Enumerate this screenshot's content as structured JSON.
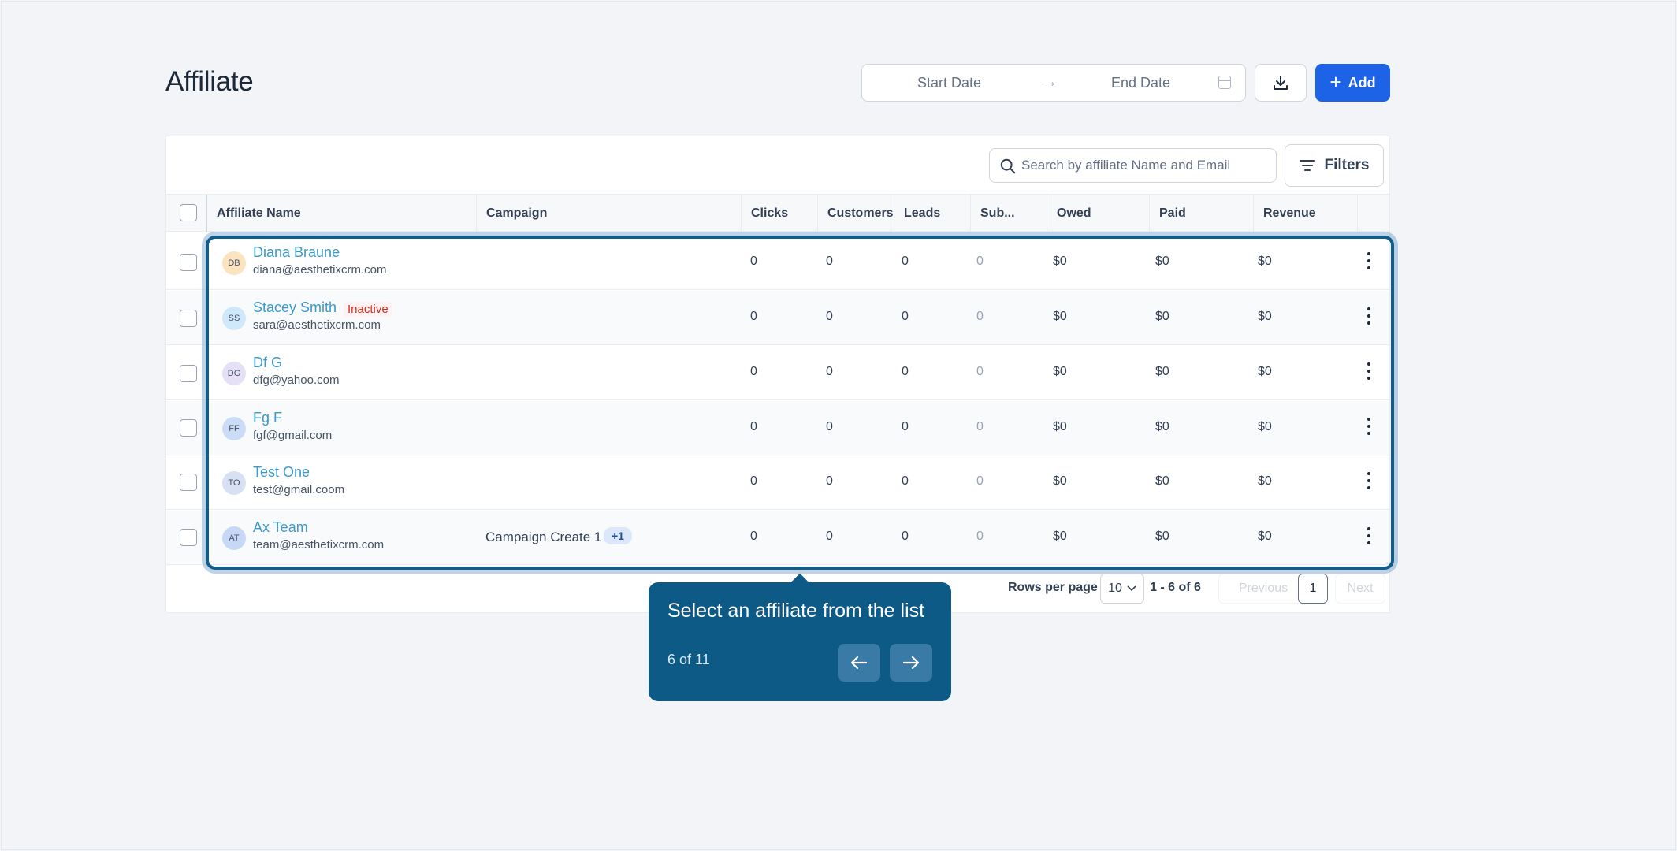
{
  "header": {
    "title": "Affiliate",
    "start_date_placeholder": "Start Date",
    "end_date_placeholder": "End Date",
    "add_label": "Add"
  },
  "toolbar": {
    "search_placeholder": "Search by affiliate Name and Email",
    "filters_label": "Filters"
  },
  "table": {
    "columns": [
      "Affiliate Name",
      "Campaign",
      "Clicks",
      "Customers",
      "Leads",
      "Sub...",
      "Owed",
      "Paid",
      "Revenue"
    ],
    "rows": [
      {
        "initials": "DB",
        "name": "Diana Braune",
        "email": "diana@aesthetixcrm.com",
        "status": "",
        "campaign": "",
        "campaign_extra": "",
        "clicks": "0",
        "customers": "0",
        "leads": "0",
        "sub": "0",
        "owed": "$0",
        "paid": "$0",
        "revenue": "$0",
        "avatar_color": "#fbe3c0"
      },
      {
        "initials": "SS",
        "name": "Stacey Smith",
        "email": "sara@aesthetixcrm.com",
        "status": "Inactive",
        "campaign": "",
        "campaign_extra": "",
        "clicks": "0",
        "customers": "0",
        "leads": "0",
        "sub": "0",
        "owed": "$0",
        "paid": "$0",
        "revenue": "$0",
        "avatar_color": "#cfe9fa"
      },
      {
        "initials": "DG",
        "name": "Df G",
        "email": "dfg@yahoo.com",
        "status": "",
        "campaign": "",
        "campaign_extra": "",
        "clicks": "0",
        "customers": "0",
        "leads": "0",
        "sub": "0",
        "owed": "$0",
        "paid": "$0",
        "revenue": "$0",
        "avatar_color": "#e6e0f7"
      },
      {
        "initials": "FF",
        "name": "Fg F",
        "email": "fgf@gmail.com",
        "status": "",
        "campaign": "",
        "campaign_extra": "",
        "clicks": "0",
        "customers": "0",
        "leads": "0",
        "sub": "0",
        "owed": "$0",
        "paid": "$0",
        "revenue": "$0",
        "avatar_color": "#cbdcf6"
      },
      {
        "initials": "TO",
        "name": "Test One",
        "email": "test@gmail.coom",
        "status": "",
        "campaign": "",
        "campaign_extra": "",
        "clicks": "0",
        "customers": "0",
        "leads": "0",
        "sub": "0",
        "owed": "$0",
        "paid": "$0",
        "revenue": "$0",
        "avatar_color": "#d8e0f4"
      },
      {
        "initials": "AT",
        "name": "Ax Team",
        "email": "team@aesthetixcrm.com",
        "status": "",
        "campaign": "Campaign Create 1",
        "campaign_extra": "+1",
        "clicks": "0",
        "customers": "0",
        "leads": "0",
        "sub": "0",
        "owed": "$0",
        "paid": "$0",
        "revenue": "$0",
        "avatar_color": "#c7d8f7"
      }
    ]
  },
  "pagination": {
    "rows_per_page_label": "Rows per page",
    "rows_per_page_value": "10",
    "range": "1 - 6 of 6",
    "previous_label": "Previous",
    "page": "1",
    "next_label": "Next"
  },
  "tour": {
    "title": "Select an affiliate from the list",
    "step": "6 of 11"
  },
  "colors": {
    "accent": "#1d63e8",
    "tour_bg": "#0e5a87",
    "link": "#3b9ac9",
    "inactive": "#d92d20"
  },
  "icons": [
    "calendar-icon",
    "download-icon",
    "plus-icon",
    "search-icon",
    "filter-icon",
    "kebab-icon",
    "chevron-down-icon",
    "arrow-left-icon",
    "arrow-right-icon"
  ]
}
